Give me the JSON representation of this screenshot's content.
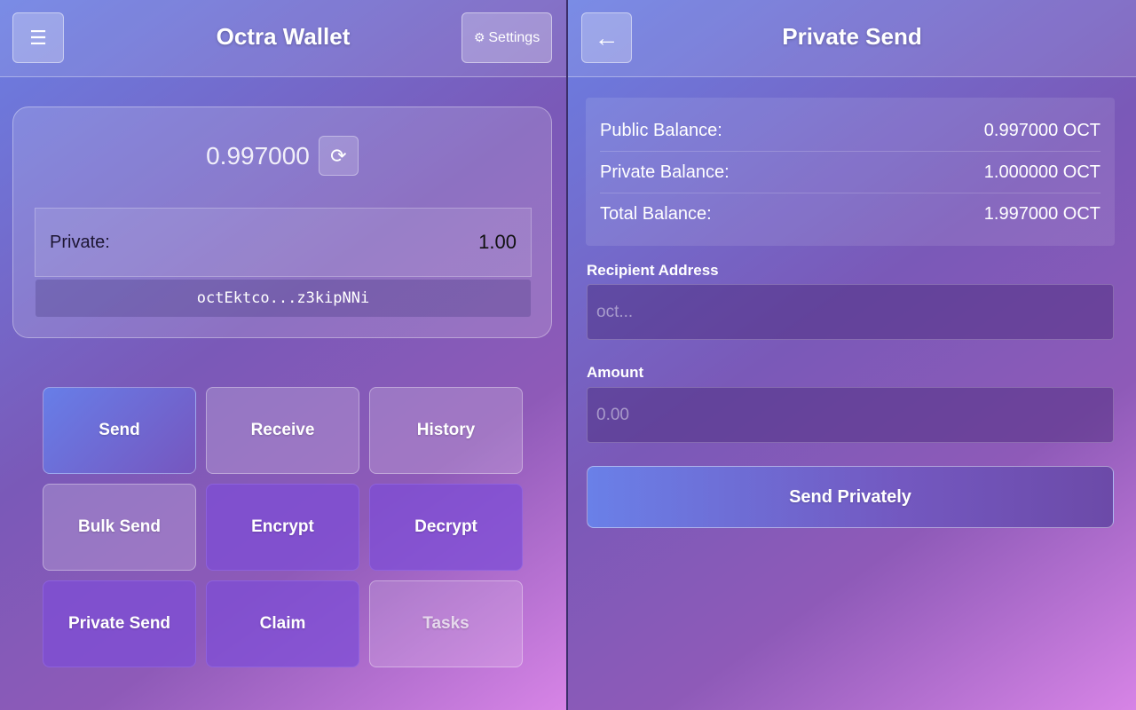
{
  "wallet": {
    "title": "Octra Wallet",
    "menu_icon": "☰",
    "settings_icon": "⚙",
    "settings_label": "Settings",
    "balance": "0.997000",
    "refresh_icon": "⟳",
    "private_label": "Private:",
    "private_value": "1.00",
    "address": "octEktco...z3kipNNi",
    "actions": [
      {
        "label": "Send"
      },
      {
        "label": "Receive"
      },
      {
        "label": "History"
      },
      {
        "label": "Bulk Send"
      },
      {
        "label": "Encrypt"
      },
      {
        "label": "Decrypt"
      },
      {
        "label": "Private Send"
      },
      {
        "label": "Claim"
      },
      {
        "label": "Tasks"
      }
    ]
  },
  "private_send": {
    "title": "Private Send",
    "back_icon": "←",
    "balances": [
      {
        "label": "Public Balance:",
        "value": "0.997000 OCT"
      },
      {
        "label": "Private Balance:",
        "value": "1.000000 OCT"
      },
      {
        "label": "Total Balance:",
        "value": "1.997000 OCT"
      }
    ],
    "recipient_label": "Recipient Address",
    "recipient_placeholder": "oct...",
    "recipient_value": "",
    "amount_label": "Amount",
    "amount_placeholder": "0.00",
    "amount_value": "",
    "submit_label": "Send Privately"
  }
}
